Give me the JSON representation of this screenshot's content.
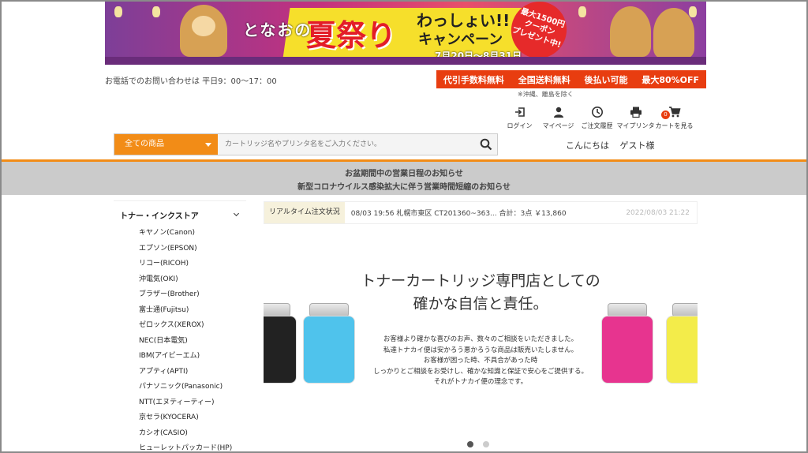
{
  "banner": {
    "brand": "となおの",
    "festival": "夏祭り",
    "wassho": "わっしょい!!",
    "campaign": "キャンペーン",
    "dates": "7月20日〜8月31日",
    "coupon_line1": "最大1500円",
    "coupon_line2": "クーポン",
    "coupon_line3": "プレゼント中!"
  },
  "contact": "お電話でのお問い合わせは 平日9：00〜17：00",
  "features": [
    "代引手数料無料",
    "全国送料無料",
    "後払い可能",
    "最大80%OFF"
  ],
  "features_note": "※沖縄、離島を除く",
  "header_icons": [
    {
      "name": "login-icon",
      "glyph": "⇥",
      "label": "ログイン"
    },
    {
      "name": "user-icon",
      "glyph": "●",
      "label": "マイページ"
    },
    {
      "name": "history-icon",
      "glyph": "◷",
      "label": "ご注文履歴"
    },
    {
      "name": "printer-icon",
      "glyph": "▣",
      "label": "マイプリンタ"
    },
    {
      "name": "cart-icon",
      "glyph": "🛒",
      "label": "カートを見る",
      "badge": "0"
    }
  ],
  "search": {
    "category": "全ての商品",
    "placeholder": "カートリッジ名やプリンタ名をご入力ください。"
  },
  "greeting": {
    "hello": "こんにちは",
    "user": "ゲスト様"
  },
  "notice": [
    "お盆期間中の営業日程のお知らせ",
    "新型コロナウイルス感染拡大に伴う営業時間短縮のお知らせ"
  ],
  "sidebar": {
    "heading": "トナー・インクストア",
    "items": [
      "キヤノン(Canon)",
      "エプソン(EPSON)",
      "リコー(RICOH)",
      "沖電気(OKI)",
      "ブラザー(Brother)",
      "富士通(Fujitsu)",
      "ゼロックス(XEROX)",
      "NEC(日本電気)",
      "IBM(アイビーエム)",
      "アプティ(APTI)",
      "パナソニック(Panasonic)",
      "NTT(エヌティーティー)",
      "京セラ(KYOCERA)",
      "カシオ(CASIO)",
      "ヒューレットパッカード(HP)"
    ]
  },
  "realtime": {
    "label": "リアルタイム注文状況",
    "message": "08/03 19:56 札幌市東区 CT201360~363... 合計：3点 ￥13,860",
    "timestamp": "2022/08/03 21:22"
  },
  "hero": {
    "title_line1": "トナーカートリッジ専門店としての",
    "title_line2": "確かな自信と責任。",
    "body": [
      "お客様より確かな喜びのお声、数々のご相談をいただきました。",
      "私達トナカイ便は安かろう悪かろうな商品は販売いたしません。",
      "お客様が困った時、不具合があった時",
      "しっかりとご相談をお受けし、確かな知識と保証で安心をご提供する。",
      "それがトナカイ便の理念です。"
    ],
    "jar_colors": [
      "#222222",
      "#4fc3ec",
      "#e7348f",
      "#f3ec4a"
    ]
  },
  "carousel": {
    "total": 2,
    "active": 0
  }
}
